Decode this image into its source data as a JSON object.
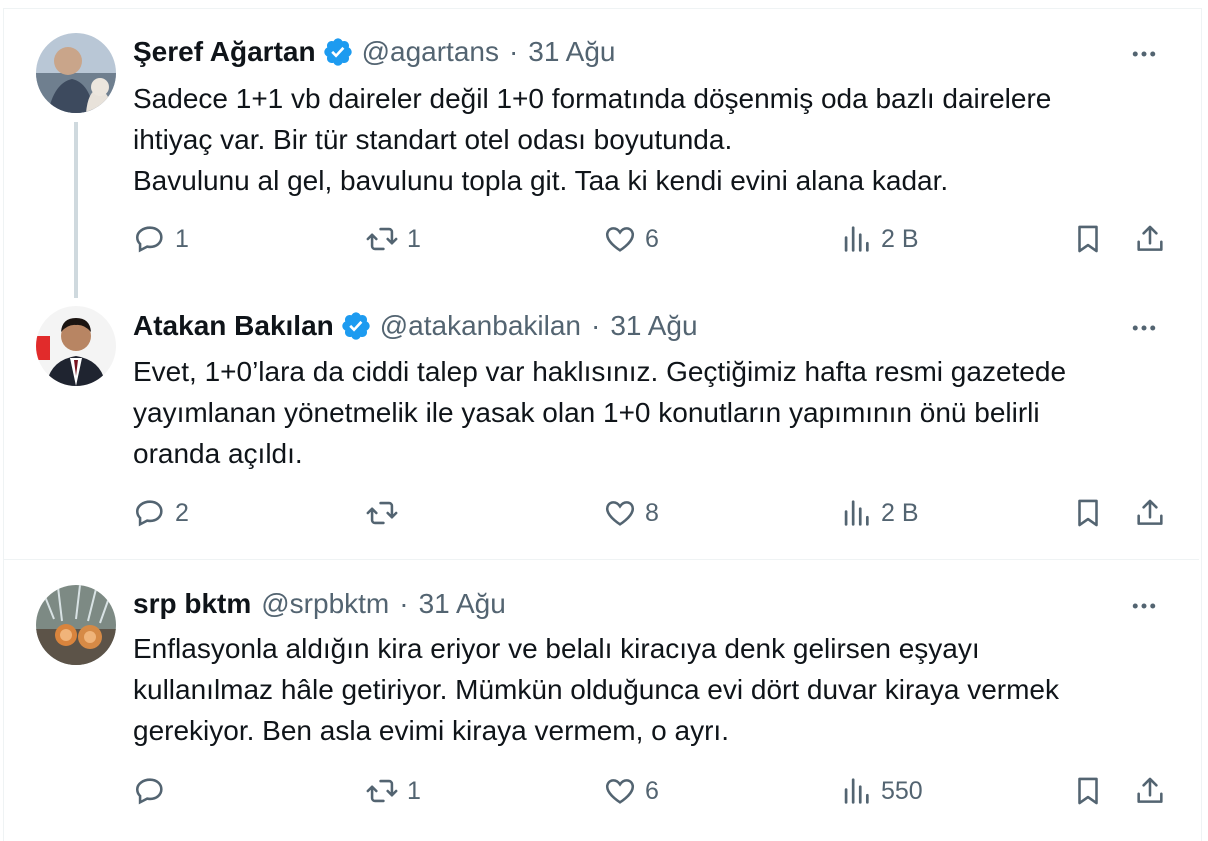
{
  "tweets": [
    {
      "name": "Şeref Ağartan",
      "handle": "@agartans",
      "date": "31 Ağu",
      "verified": true,
      "text": "Sadece 1+1 vb daireler değil 1+0 formatında döşenmiş oda bazlı dairelere\nihtiyaç var. Bir tür standart otel odası boyutunda.\nBavulunu al gel, bavulunu topla git. Taa ki kendi evini alana kadar.",
      "replies": "1",
      "reposts": "1",
      "likes": "6",
      "views": "2 B"
    },
    {
      "name": "Atakan Bakılan",
      "handle": "@atakanbakilan",
      "date": "31 Ağu",
      "verified": true,
      "text": "Evet, 1+0’lara da ciddi talep var haklısınız. Geçtiğimiz hafta resmi gazetede\nyayımlanan yönetmelik ile yasak olan 1+0 konutların yapımının önü belirli\noranda açıldı.",
      "replies": "2",
      "reposts": "",
      "likes": "8",
      "views": "2 B"
    },
    {
      "name": "srp bktm",
      "handle": "@srpbktm",
      "date": "31 Ağu",
      "verified": false,
      "text": "Enflasyonla aldığın kira eriyor ve belalı kiracıya denk gelirsen eşyayı\nkullanılmaz hâle getiriyor.  Mümkün olduğunca evi dört duvar kiraya vermek\ngerekiyor. Ben asla evimi kiraya vermem, o ayrı.",
      "replies": "",
      "reposts": "1",
      "likes": "6",
      "views": "550"
    }
  ],
  "colors": {
    "text": "#0f1419",
    "muted": "#536471",
    "verified": "#1d9bf0",
    "border": "#eff3f4",
    "thread": "#cfd9de"
  },
  "icons": [
    "reply-icon",
    "repost-icon",
    "like-icon",
    "views-icon",
    "bookmark-icon",
    "share-icon",
    "more-icon",
    "verified-badge-icon"
  ]
}
